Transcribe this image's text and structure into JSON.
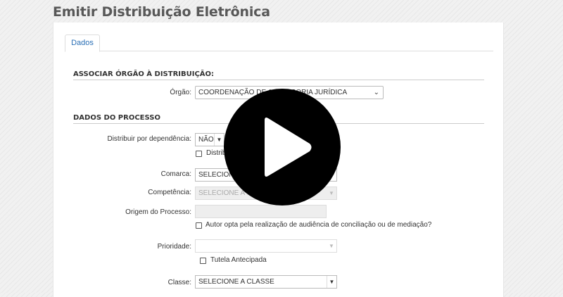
{
  "page": {
    "title": "Emitir Distribuição Eletrônica"
  },
  "tabs": [
    {
      "label": "Dados",
      "active": true
    }
  ],
  "section_orgao": {
    "title": "ASSOCIAR ÓRGÃO À DISTRIBUIÇÃO:",
    "orgao_label": "Órgão:",
    "orgao_value": "COORDENAÇÃO DE ASSESSORIA JURÍDICA"
  },
  "section_processo": {
    "title": "DADOS DO PROCESSO",
    "dependencia_label": "Distribuir por dependência:",
    "dependencia_value": "NÃO",
    "dependencia_checkbox_label": "Distribuir",
    "comarca_label": "Comarca:",
    "comarca_value": "SELECIONE A COMARCA",
    "competencia_label": "Competência:",
    "competencia_value": "SELECIONE A COMPETÊNCIA",
    "origem_label": "Origem do Processo:",
    "origem_value": "",
    "autor_checkbox_label": "Autor opta pela realização de audiência de conciliação ou de mediação?",
    "prioridade_label": "Prioridade:",
    "prioridade_value": "",
    "tutela_checkbox_label": "Tutela Antecipada",
    "classe_label": "Classe:",
    "classe_value": "SELECIONE A CLASSE"
  },
  "icons": {
    "play": "play-icon",
    "dropdown": "chevron-down-icon"
  },
  "colors": {
    "tab_text": "#2a6fb5",
    "overlay": "#000000",
    "background": "#f1f1f1"
  }
}
